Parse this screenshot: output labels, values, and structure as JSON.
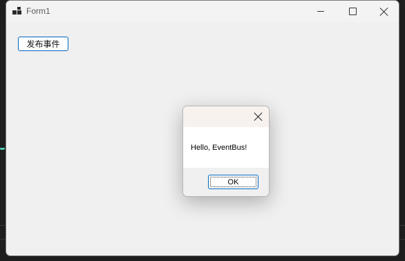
{
  "window": {
    "title": "Form1",
    "icon": "winforms-app-icon",
    "controls": [
      "minimize-icon",
      "maximize-icon",
      "close-icon"
    ]
  },
  "form": {
    "publish_button_label": "发布事件"
  },
  "messagebox": {
    "message": "Hello, EventBus!",
    "ok_label": "OK"
  },
  "colors": {
    "accent": "#0067c0",
    "form_background": "#f0f0f0",
    "dialog_titlebar": "#f8f2ef"
  }
}
